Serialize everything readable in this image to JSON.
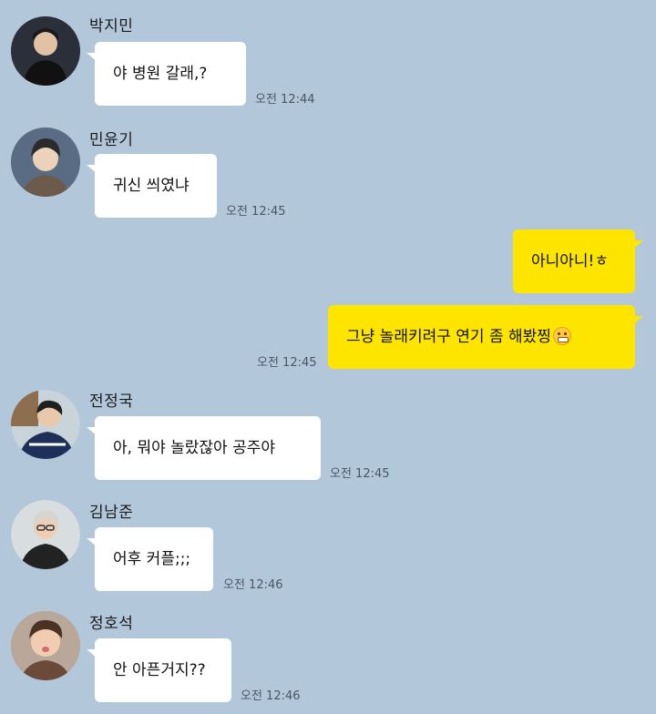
{
  "messages": [
    {
      "sender": "박지민",
      "text": "야 병원 갈래,?",
      "time": "오전 12:44",
      "avatar_icon": "profile-photo"
    },
    {
      "sender": "민윤기",
      "text": "귀신 씌였냐",
      "time": "오전 12:45",
      "avatar_icon": "profile-photo"
    },
    {
      "sender": "me",
      "text": "아니아니!ㅎ",
      "time": "",
      "avatar_icon": ""
    },
    {
      "sender": "me",
      "text": "그냥 놀래키려구 연기 좀 해봤찡",
      "emoji": "grinning-face-emoji",
      "time": "오전 12:45",
      "avatar_icon": ""
    },
    {
      "sender": "전정국",
      "text": "아, 뭐야 놀랐잖아 공주야",
      "time": "오전 12:45",
      "avatar_icon": "profile-photo"
    },
    {
      "sender": "김남준",
      "text": "어후 커플;;;",
      "time": "오전 12:46",
      "avatar_icon": "profile-photo"
    },
    {
      "sender": "정호석",
      "text": "안 아픈거지??",
      "time": "오전 12:46",
      "avatar_icon": "profile-photo"
    }
  ],
  "colors": {
    "background": "#b2c7da",
    "incoming_bubble": "#ffffff",
    "outgoing_bubble": "#fee500"
  }
}
